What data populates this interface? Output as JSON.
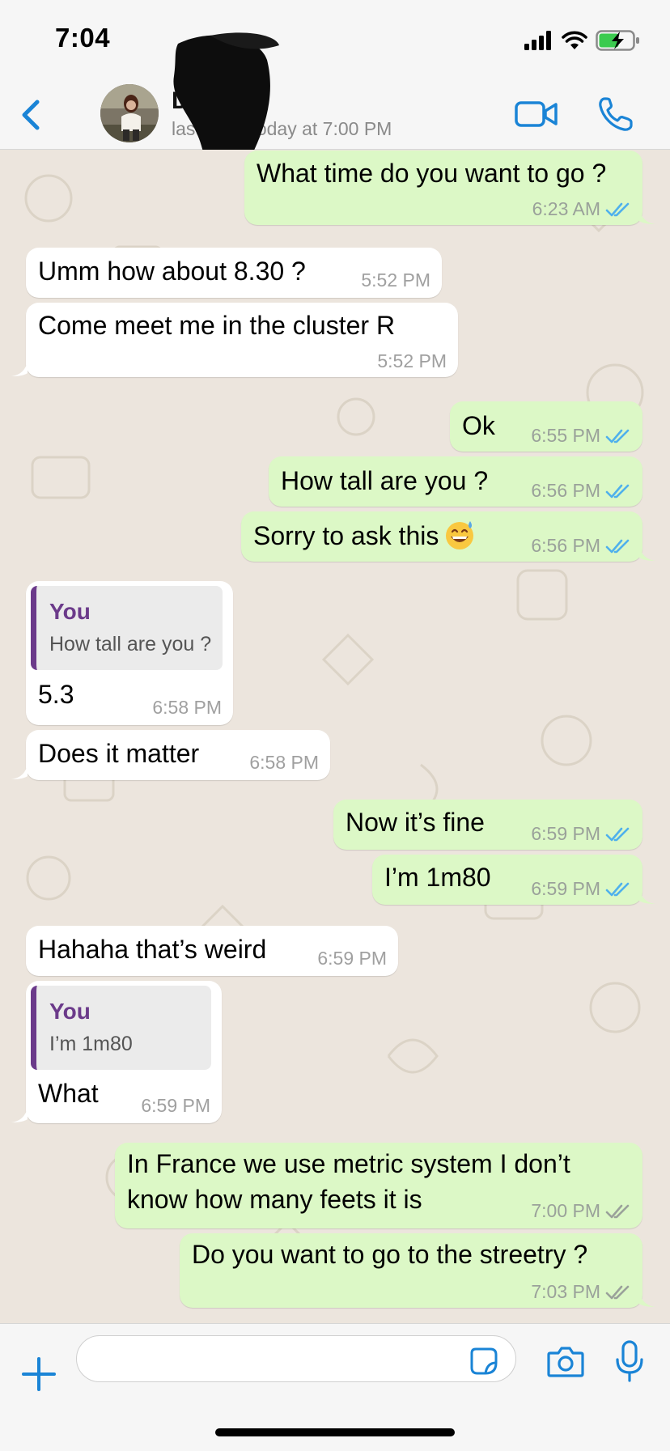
{
  "status_bar": {
    "time": "7:04",
    "icons": [
      "signal-icon",
      "wifi-icon",
      "battery-charging-icon"
    ]
  },
  "header": {
    "back_icon": "chevron-left-icon",
    "contact_name": "Divya",
    "contact_status": "last seen today at 7:00 PM",
    "video_call_icon": "video-camera-icon",
    "voice_call_icon": "phone-icon",
    "accent_color": "#1a84d6"
  },
  "messages": [
    {
      "direction": "out",
      "text": "What time do you want to go ?",
      "time": "6:23 AM",
      "status": "read"
    },
    {
      "direction": "in",
      "text": "Umm how about 8.30 ?",
      "time": "5:52 PM"
    },
    {
      "direction": "in",
      "text": "Come meet me in the cluster R",
      "time": "5:52 PM"
    },
    {
      "direction": "out",
      "text": "Ok",
      "time": "6:55 PM",
      "status": "read"
    },
    {
      "direction": "out",
      "text": "How tall are you ?",
      "time": "6:56 PM",
      "status": "read"
    },
    {
      "direction": "out",
      "text": "Sorry to ask this",
      "emoji": "grinning-sweat-emoji",
      "time": "6:56 PM",
      "status": "read"
    },
    {
      "direction": "in",
      "quote": {
        "name": "You",
        "text": "How tall are you ?"
      },
      "text": "5.3",
      "time": "6:58 PM"
    },
    {
      "direction": "in",
      "text": "Does it matter",
      "time": "6:58 PM"
    },
    {
      "direction": "out",
      "text": "Now it’s fine",
      "time": "6:59 PM",
      "status": "read"
    },
    {
      "direction": "out",
      "text": "I’m 1m80",
      "time": "6:59 PM",
      "status": "read"
    },
    {
      "direction": "in",
      "text": "Hahaha that’s weird",
      "time": "6:59 PM"
    },
    {
      "direction": "in",
      "quote": {
        "name": "You",
        "text": "I’m 1m80"
      },
      "text": "What",
      "time": "6:59 PM"
    },
    {
      "direction": "out",
      "text_lines": [
        "In France we use metric system I don’t",
        "know how many feets it is"
      ],
      "time": "7:00 PM",
      "status": "delivered"
    },
    {
      "direction": "out",
      "text": "Do you want to go to the streetry ?",
      "time": "7:03 PM",
      "status": "delivered"
    }
  ],
  "composer": {
    "input_value": "",
    "icons": [
      "plus-icon",
      "sticker-icon",
      "camera-icon",
      "microphone-icon"
    ]
  },
  "colors": {
    "outgoing_bubble": "#dcf8c6",
    "incoming_bubble": "#ffffff",
    "chat_background": "#ece5dd",
    "read_tick": "#4fb0ec",
    "delivered_tick": "#9aa19a",
    "quote_accent": "#6b3a8a"
  }
}
